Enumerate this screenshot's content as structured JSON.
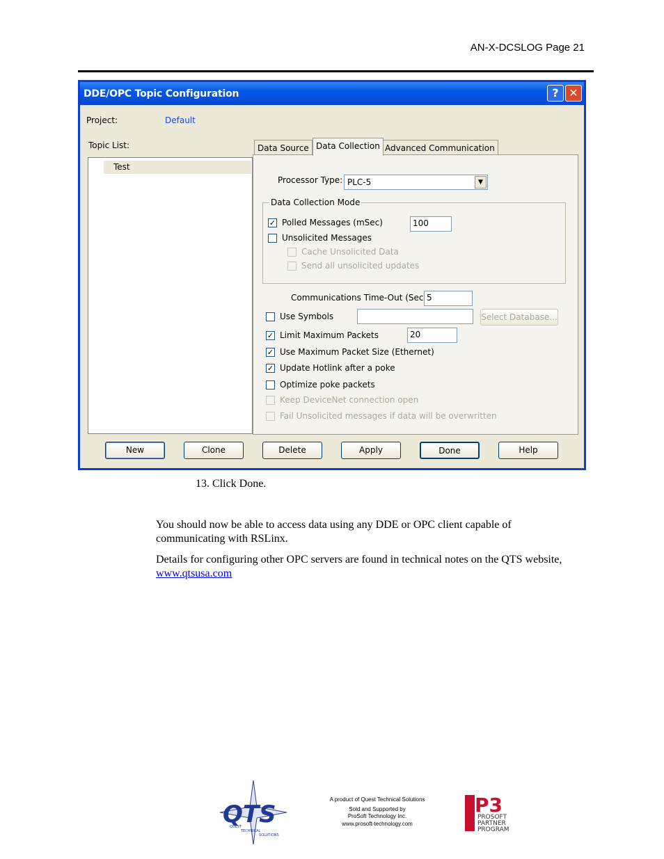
{
  "header": {
    "text": "AN-X-DCSLOG  Page 21"
  },
  "dialog": {
    "title": "DDE/OPC Topic Configuration",
    "help_glyph": "?",
    "close_glyph": "✕",
    "project_label": "Project:",
    "project_value": "Default",
    "topic_list_label": "Topic List:",
    "topics": [
      "Test"
    ],
    "tabs": [
      "Data Source",
      "Data Collection",
      "Advanced Communication"
    ],
    "active_tab": "Data Collection",
    "processor_type_label": "Processor Type:",
    "processor_type_value": "PLC-5",
    "mode_group_title": "Data Collection Mode",
    "polled_label": "Polled Messages (mSec)",
    "polled_value": "100",
    "unsolicited_label": "Unsolicited Messages",
    "cache_label": "Cache Unsolicited Data",
    "send_all_label": "Send all unsolicited updates",
    "timeout_label": "Communications Time-Out (Secs):",
    "timeout_value": "5",
    "use_symbols_label": "Use Symbols",
    "symbols_value": "",
    "select_db_label": "Select Database...",
    "limit_packets_label": "Limit Maximum Packets",
    "limit_packets_value": "20",
    "max_packet_label": "Use Maximum Packet Size (Ethernet)",
    "hotlink_label": "Update Hotlink after a poke",
    "optimize_label": "Optimize poke packets",
    "keep_devicenet_label": "Keep DeviceNet connection open",
    "fail_unsolicited_label": "Fail Unsolicited messages if data will be overwritten",
    "check_mark": "✓",
    "checks": {
      "polled": true,
      "unsolicited": false,
      "cache": false,
      "send_all": false,
      "use_symbols": false,
      "limit_packets": true,
      "max_packet": true,
      "hotlink": true,
      "optimize": false,
      "keep_devicenet": false,
      "fail_unsolicited": false
    },
    "buttons": {
      "new": "New",
      "clone": "Clone",
      "delete": "Delete",
      "apply": "Apply",
      "done": "Done",
      "help": "Help"
    }
  },
  "step": "13. Click Done.",
  "body": {
    "para1": "You should now be able to access data using any DDE or OPC client capable of communicating with RSLinx.",
    "para2_prefix": "Details for configuring other OPC servers are found in technical notes on the QTS website, ",
    "link": "www.qtsusa.com"
  },
  "footer": {
    "line1": "A product of Quest Technical Solutions",
    "line2": "Sold and Supported by",
    "line3": "ProSoft Technology Inc.",
    "line4": "www.prosoft-technology.com",
    "qts_logo_text": "QTS",
    "qts_sub1": "QUEST",
    "qts_sub2": "TECHNICAL",
    "qts_sub3": "SOLUTIONS",
    "p3_logo": "P3",
    "p3_line1": "PROSOFT",
    "p3_line2": "PARTNER",
    "p3_line3": "PROGRAM"
  },
  "colors": {
    "titlebar": "#0058e6",
    "link": "#0000ee",
    "project_value": "#1848e0"
  }
}
